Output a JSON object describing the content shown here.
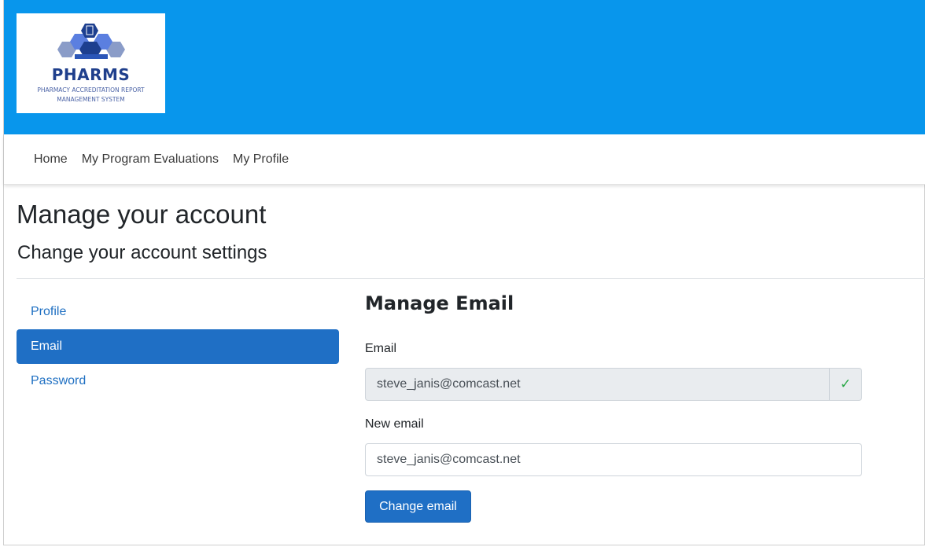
{
  "logo": {
    "name": "PHARMS",
    "subtitle_line1": "PHARMACY ACCREDITATION REPORT",
    "subtitle_line2": "MANAGEMENT SYSTEM",
    "icon": "hexagon-logo-icon"
  },
  "nav": {
    "items": [
      "Home",
      "My Program Evaluations",
      "My Profile"
    ]
  },
  "page": {
    "title": "Manage your account",
    "subtitle": "Change your account settings"
  },
  "sidebar": {
    "items": [
      {
        "label": "Profile",
        "active": false
      },
      {
        "label": "Email",
        "active": true
      },
      {
        "label": "Password",
        "active": false
      }
    ]
  },
  "manage_email": {
    "title": "Manage Email",
    "email_label": "Email",
    "email_value": "steve_janis@comcast.net",
    "verified_icon": "checkmark-icon",
    "new_email_label": "New email",
    "new_email_value": "steve_janis@comcast.net",
    "submit_label": "Change email"
  },
  "colors": {
    "banner": "#0896ec",
    "primary": "#1f6fc5",
    "link": "#1e6fc2",
    "success": "#28a745"
  }
}
